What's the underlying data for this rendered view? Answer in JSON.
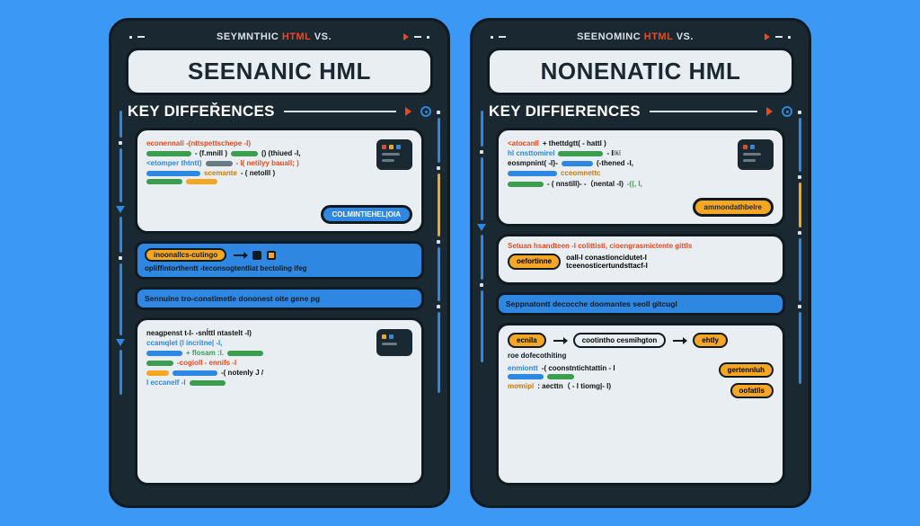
{
  "leftPanel": {
    "tagline_pre": "SEYMNTHIC",
    "tagline_accent": "HTML",
    "tagline_post": "VS.",
    "title": "SEENANIC HML",
    "subtitle": "KEY DIFFEŘENCES",
    "card1": {
      "line1_a": "econennall   -(nttspettschepe -I)",
      "line2_a": "- (f.mnill )",
      "line2_b": "() (thiued -I,",
      "line3_a": "<etomper thtntt)",
      "line3_b": "- I( netilyy bauall; )",
      "line4_a": "scemante",
      "line4_b": "- ( netolll )",
      "pill": "COLMINTIEHEL|OIA"
    },
    "footbar1": {
      "pill": "inoonallcs-cutingo",
      "text": "opliffintorthentt -teconsogtentliat bectoling ifeg"
    },
    "footbar2": {
      "text": "Sennuine tro-constimetle dononest oite gene pg"
    },
    "card2": {
      "l1": "neagpenst t-I- -snĺttl    ntastelt -I)",
      "l2": "ccamqlet (l  incritne| -I,",
      "l3": "+ flosam :l.",
      "l4": "-cogioll   - ennifs -I",
      "l5": "-( notenly  J /",
      "l6": "I eccanelf -l"
    }
  },
  "rightPanel": {
    "tagline_pre": "SEENOMINC",
    "tagline_accent": "HTML",
    "tagline_post": "VS.",
    "title": "NONENATIC HML",
    "subtitle": "KEY DIFFIERENCES",
    "card1": {
      "l1a": "<atocanll",
      "l1b": "+ thettdgtt( - hattl )",
      "l2a": "hI cnsttomirel",
      "l2b": "- I￼",
      "l3a": "eosmpnint( -I}-",
      "l3b": "(-thened -I,",
      "l4a": "cceomnettc",
      "l5a": "- ( nnstill)- -（nental -I)",
      "l5b": "-((, I,",
      "pill": "ammondathbelre"
    },
    "mid": {
      "hdr": "Setuan hsandteen  -I colittisti, cioengrasmictente gittls",
      "tag1": "oefortinne",
      "txt1": "oall-I conastioncidutet-I",
      "txt2": "tceenosticertundsttacf-I"
    },
    "footbar": {
      "text": "Seppnatontt decocche doomantes seoll gitcugl"
    },
    "card2": {
      "tag_a": "ecnila",
      "tag_b": "cootintho cesmihgton",
      "tag_c": "ehtly",
      "foot_lbl": "roe dofecothiting",
      "l1a": "enmiontt",
      "l1b": "-( coonstntichtattin - I",
      "tag_d": "gertennluh",
      "l2a": "mơmipl",
      "l2b": ": aecttn（  - I tiomg|- I)",
      "tag_e": "oofatlls"
    }
  }
}
